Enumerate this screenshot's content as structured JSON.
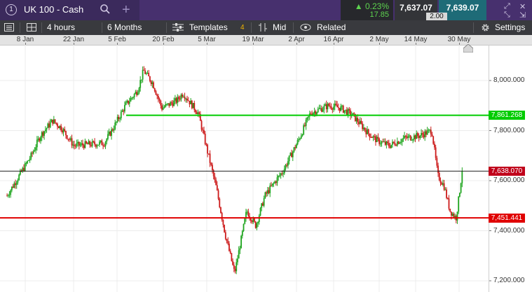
{
  "topbar": {
    "tab_number": "1",
    "instrument": "UK 100 - Cash",
    "change_pct": "0.23%",
    "change_abs": "17.85",
    "sell_price": "7,637.07",
    "buy_price": "7,639.07",
    "spread": "2.00"
  },
  "toolbar": {
    "interval": "4 hours",
    "range": "6 Months",
    "templates": "Templates",
    "templates_count": "4",
    "price_type": "Mid",
    "related": "Related",
    "settings": "Settings"
  },
  "chart_data": {
    "type": "candlestick",
    "x_tick_labels": [
      "8 Jan",
      "22 Jan",
      "5 Feb",
      "20 Feb",
      "5 Mar",
      "19 Mar",
      "2 Apr",
      "16 Apr",
      "2 May",
      "14 May",
      "30 May"
    ],
    "y_tick_labels": [
      "8,000.000",
      "7,800.000",
      "7,600.000",
      "7,400.000",
      "7,200.000"
    ],
    "y_ticks": [
      8000,
      7800,
      7600,
      7400,
      7200
    ],
    "ylim": [
      7190,
      8170
    ],
    "current_price_label": "7,638.070",
    "current_price": 7638.07,
    "horizontal_lines": [
      {
        "label": "7,861.268",
        "value": 7861.268,
        "color": "#00cc00"
      },
      {
        "label": "7,451.441",
        "value": 7451.441,
        "color": "#e00000"
      }
    ],
    "series_keypoints": [
      {
        "date": "2 Jan",
        "value": 7540
      },
      {
        "date": "10 Jan",
        "value": 7700
      },
      {
        "date": "13 Jan",
        "value": 7780
      },
      {
        "date": "17 Jan",
        "value": 7840
      },
      {
        "date": "20 Jan",
        "value": 7810
      },
      {
        "date": "24 Jan",
        "value": 7740
      },
      {
        "date": "3 Feb",
        "value": 7750
      },
      {
        "date": "6 Feb",
        "value": 7810
      },
      {
        "date": "10 Feb",
        "value": 7900
      },
      {
        "date": "14 Feb",
        "value": 7960
      },
      {
        "date": "16 Feb",
        "value": 8040
      },
      {
        "date": "19 Feb",
        "value": 7990
      },
      {
        "date": "22 Feb",
        "value": 7890
      },
      {
        "date": "27 Feb",
        "value": 7920
      },
      {
        "date": "1 Mar",
        "value": 7950
      },
      {
        "date": "6 Mar",
        "value": 7870
      },
      {
        "date": "9 Mar",
        "value": 7720
      },
      {
        "date": "12 Mar",
        "value": 7570
      },
      {
        "date": "15 Mar",
        "value": 7380
      },
      {
        "date": "18 Mar",
        "value": 7230
      },
      {
        "date": "22 Mar",
        "value": 7480
      },
      {
        "date": "25 Mar",
        "value": 7420
      },
      {
        "date": "28 Mar",
        "value": 7540
      },
      {
        "date": "3 Apr",
        "value": 7640
      },
      {
        "date": "8 Apr",
        "value": 7760
      },
      {
        "date": "12 Apr",
        "value": 7870
      },
      {
        "date": "18 Apr",
        "value": 7900
      },
      {
        "date": "22 Apr",
        "value": 7890
      },
      {
        "date": "26 Apr",
        "value": 7860
      },
      {
        "date": "1 May",
        "value": 7790
      },
      {
        "date": "4 May",
        "value": 7760
      },
      {
        "date": "8 May",
        "value": 7740
      },
      {
        "date": "13 May",
        "value": 7770
      },
      {
        "date": "18 May",
        "value": 7780
      },
      {
        "date": "22 May",
        "value": 7800
      },
      {
        "date": "24 May",
        "value": 7620
      },
      {
        "date": "26 May",
        "value": 7580
      },
      {
        "date": "28 May",
        "value": 7480
      },
      {
        "date": "30 May",
        "value": 7450
      },
      {
        "date": "31 May",
        "value": 7540
      },
      {
        "date": "1 Jun",
        "value": 7638
      }
    ],
    "up_color": "#1fa51f",
    "down_color": "#cc1b1b"
  }
}
